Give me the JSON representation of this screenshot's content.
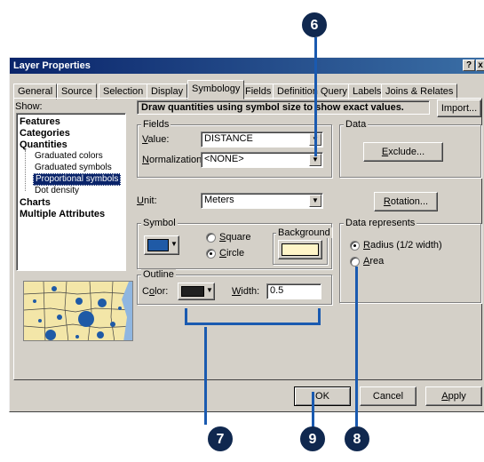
{
  "window": {
    "title": "Layer Properties",
    "help_button": "?",
    "close_button": "x"
  },
  "tabs": [
    {
      "label": "General",
      "active": false
    },
    {
      "label": "Source",
      "active": false
    },
    {
      "label": "Selection",
      "active": false
    },
    {
      "label": "Display",
      "active": false
    },
    {
      "label": "Symbology",
      "active": true
    },
    {
      "label": "Fields",
      "active": false
    },
    {
      "label": "Definition Query",
      "active": false
    },
    {
      "label": "Labels",
      "active": false
    },
    {
      "label": "Joins & Relates",
      "active": false
    }
  ],
  "show": {
    "label": "Show:",
    "items": [
      {
        "label": "Features",
        "level": 0
      },
      {
        "label": "Categories",
        "level": 0
      },
      {
        "label": "Quantities",
        "level": 0
      },
      {
        "label": "Graduated colors",
        "level": 1
      },
      {
        "label": "Graduated symbols",
        "level": 1
      },
      {
        "label": "Proportional symbols",
        "level": 1,
        "selected": true
      },
      {
        "label": "Dot density",
        "level": 1
      },
      {
        "label": "Charts",
        "level": 0
      },
      {
        "label": "Multiple Attributes",
        "level": 0
      }
    ]
  },
  "header": {
    "description": "Draw quantities using symbol size to show exact values.",
    "import_button": "Import..."
  },
  "fields": {
    "group_label": "Fields",
    "value_label": "Value:",
    "value": "DISTANCE",
    "normalization_label": "Normalization:",
    "normalization": "<NONE>"
  },
  "data": {
    "group_label": "Data",
    "exclude_button": "Exclude..."
  },
  "unit": {
    "label": "Unit:",
    "value": "Meters",
    "rotation_button": "Rotation..."
  },
  "symbol": {
    "group_label": "Symbol",
    "square_label": "Square",
    "circle_label": "Circle",
    "background_label": "Background",
    "symbol_color": "#1f5aa6",
    "background_color": "#fff5c8"
  },
  "outline": {
    "group_label": "Outline",
    "color_label": "Color:",
    "color": "#202020",
    "width_label": "Width:",
    "width_value": "0.5"
  },
  "data_represents": {
    "group_label": "Data represents",
    "radius_label": "Radius (1/2 width)",
    "area_label": "Area"
  },
  "footer": {
    "ok_button": "OK",
    "cancel_button": "Cancel",
    "apply_button": "Apply"
  },
  "callouts": {
    "c6": "6",
    "c7": "7",
    "c8": "8",
    "c9": "9"
  }
}
